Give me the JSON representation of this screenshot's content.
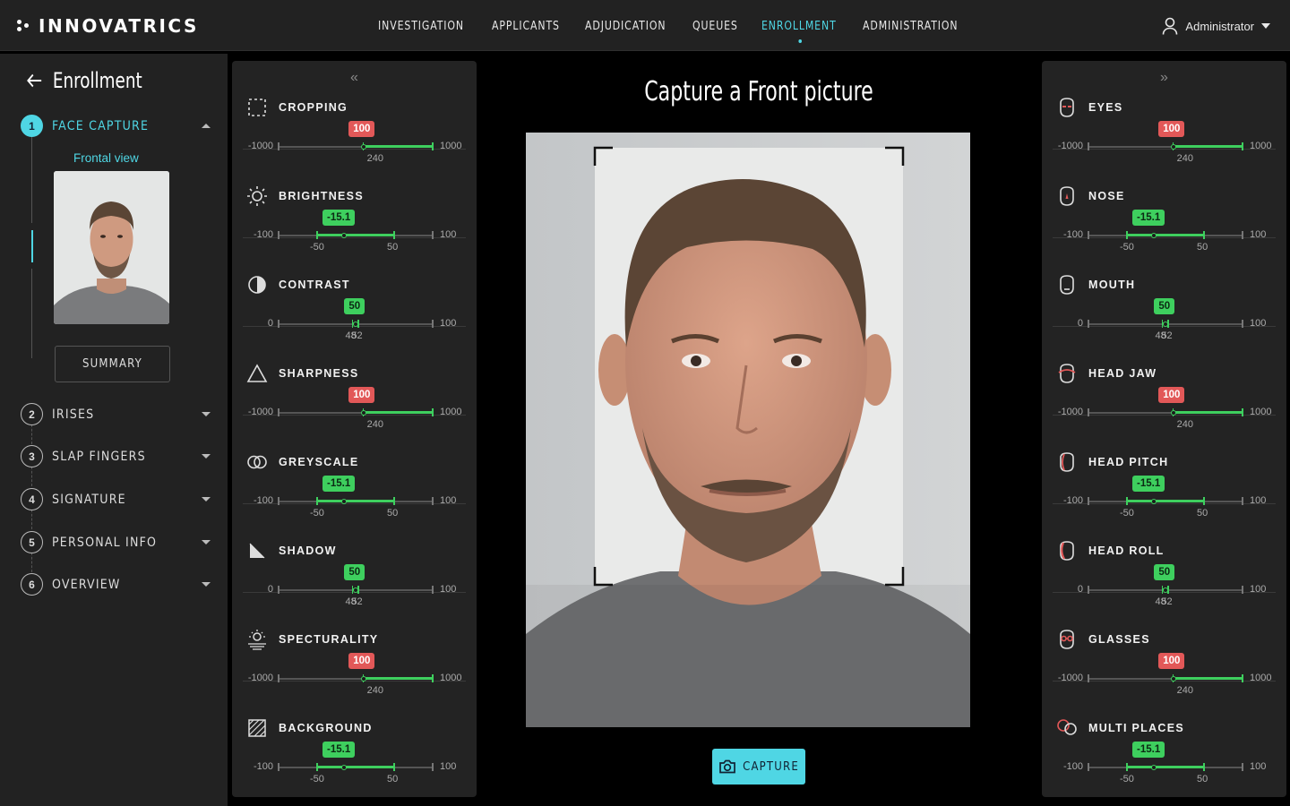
{
  "brand": {
    "name": "INNOVATRICS"
  },
  "nav": {
    "items": [
      "INVESTIGATION",
      "APPLICANTS",
      "ADJUDICATION",
      "QUEUES",
      "ENROLLMENT",
      "ADMINISTRATION"
    ],
    "active": "ENROLLMENT"
  },
  "user": {
    "name": "Administrator",
    "icon": "user-icon"
  },
  "sidebar": {
    "title": "Enrollment",
    "frontal_label": "Frontal view",
    "summary_label": "SUMMARY",
    "steps": [
      {
        "num": "1",
        "label": "FACE CAPTURE",
        "active": true
      },
      {
        "num": "2",
        "label": "IRISES"
      },
      {
        "num": "3",
        "label": "SLAP FINGERS"
      },
      {
        "num": "4",
        "label": "SIGNATURE"
      },
      {
        "num": "5",
        "label": "PERSONAL INFO"
      },
      {
        "num": "6",
        "label": "OVERVIEW"
      }
    ]
  },
  "center": {
    "title": "Capture a Front picture",
    "capture_label": "CAPTURE"
  },
  "left_panel": {
    "collapse_glyph": "«",
    "controls": [
      {
        "name": "CROPPING",
        "icon": "crop-icon",
        "min": "-1000",
        "max": "1000",
        "value": "100",
        "status": "red",
        "marks": [
          "240"
        ],
        "range": [
          -1000,
          1000
        ],
        "green_from": 100,
        "green_to": 1000,
        "ticks": [
          100,
          1000
        ],
        "mark_vals": [
          240
        ]
      },
      {
        "name": "BRIGHTNESS",
        "icon": "sun-icon",
        "min": "-100",
        "max": "100",
        "value": "-15.1",
        "status": "green",
        "marks": [
          "-50",
          "50"
        ],
        "range": [
          -100,
          100
        ],
        "green_from": -50,
        "green_to": 50,
        "ticks": [
          -50,
          50
        ],
        "mark_vals": [
          -50,
          50
        ],
        "knob": -15.1
      },
      {
        "name": "CONTRAST",
        "icon": "contrast-icon",
        "min": "0",
        "max": "100",
        "value": "50",
        "status": "green",
        "marks": [
          "48",
          "52"
        ],
        "range": [
          0,
          100
        ],
        "green_from": 48,
        "green_to": 52,
        "ticks": [
          48,
          52
        ],
        "mark_vals": [
          48,
          52
        ],
        "knob": 50
      },
      {
        "name": "SHARPNESS",
        "icon": "triangle-icon",
        "min": "-1000",
        "max": "1000",
        "value": "100",
        "status": "red",
        "marks": [
          "240"
        ],
        "range": [
          -1000,
          1000
        ],
        "green_from": 100,
        "green_to": 1000,
        "ticks": [
          100,
          1000
        ],
        "mark_vals": [
          240
        ]
      },
      {
        "name": "GREYSCALE",
        "icon": "circles-icon",
        "min": "-100",
        "max": "100",
        "value": "-15.1",
        "status": "green",
        "marks": [
          "-50",
          "50"
        ],
        "range": [
          -100,
          100
        ],
        "green_from": -50,
        "green_to": 50,
        "ticks": [
          -50,
          50
        ],
        "mark_vals": [
          -50,
          50
        ],
        "knob": -15.1
      },
      {
        "name": "SHADOW",
        "icon": "shadow-icon",
        "min": "0",
        "max": "100",
        "value": "50",
        "status": "green",
        "marks": [
          "48",
          "52"
        ],
        "range": [
          0,
          100
        ],
        "green_from": 48,
        "green_to": 52,
        "ticks": [
          48,
          52
        ],
        "mark_vals": [
          48,
          52
        ],
        "knob": 50
      },
      {
        "name": "SPECTURALITY",
        "icon": "specularity-icon",
        "min": "-1000",
        "max": "1000",
        "value": "100",
        "status": "red",
        "marks": [
          "240"
        ],
        "range": [
          -1000,
          1000
        ],
        "green_from": 100,
        "green_to": 1000,
        "ticks": [
          100,
          1000
        ],
        "mark_vals": [
          240
        ]
      },
      {
        "name": "BACKGROUND",
        "icon": "background-icon",
        "min": "-100",
        "max": "100",
        "value": "-15.1",
        "status": "green",
        "marks": [
          "-50",
          "50"
        ],
        "range": [
          -100,
          100
        ],
        "green_from": -50,
        "green_to": 50,
        "ticks": [
          -50,
          50
        ],
        "mark_vals": [
          -50,
          50
        ],
        "knob": -15.1
      }
    ]
  },
  "right_panel": {
    "collapse_glyph": "»",
    "controls": [
      {
        "name": "EYES",
        "icon": "eyes-icon",
        "min": "-1000",
        "max": "1000",
        "value": "100",
        "status": "red",
        "marks": [
          "240"
        ],
        "range": [
          -1000,
          1000
        ],
        "green_from": 100,
        "green_to": 1000,
        "ticks": [
          100,
          1000
        ],
        "mark_vals": [
          240
        ]
      },
      {
        "name": "NOSE",
        "icon": "nose-icon",
        "min": "-100",
        "max": "100",
        "value": "-15.1",
        "status": "green",
        "marks": [
          "-50",
          "50"
        ],
        "range": [
          -100,
          100
        ],
        "green_from": -50,
        "green_to": 50,
        "ticks": [
          -50,
          50
        ],
        "mark_vals": [
          -50,
          50
        ],
        "knob": -15.1
      },
      {
        "name": "MOUTH",
        "icon": "mouth-icon",
        "min": "0",
        "max": "100",
        "value": "50",
        "status": "green",
        "marks": [
          "48",
          "52"
        ],
        "range": [
          0,
          100
        ],
        "green_from": 48,
        "green_to": 52,
        "ticks": [
          48,
          52
        ],
        "mark_vals": [
          48,
          52
        ],
        "knob": 50
      },
      {
        "name": "HEAD JAW",
        "icon": "head-jaw-icon",
        "min": "-1000",
        "max": "1000",
        "value": "100",
        "status": "red",
        "marks": [
          "240"
        ],
        "range": [
          -1000,
          1000
        ],
        "green_from": 100,
        "green_to": 1000,
        "ticks": [
          100,
          1000
        ],
        "mark_vals": [
          240
        ]
      },
      {
        "name": "HEAD PITCH",
        "icon": "head-pitch-icon",
        "min": "-100",
        "max": "100",
        "value": "-15.1",
        "status": "green",
        "marks": [
          "-50",
          "50"
        ],
        "range": [
          -100,
          100
        ],
        "green_from": -50,
        "green_to": 50,
        "ticks": [
          -50,
          50
        ],
        "mark_vals": [
          -50,
          50
        ],
        "knob": -15.1
      },
      {
        "name": "HEAD ROLL",
        "icon": "head-roll-icon",
        "min": "0",
        "max": "100",
        "value": "50",
        "status": "green",
        "marks": [
          "48",
          "52"
        ],
        "range": [
          0,
          100
        ],
        "green_from": 48,
        "green_to": 52,
        "ticks": [
          48,
          52
        ],
        "mark_vals": [
          48,
          52
        ],
        "knob": 50
      },
      {
        "name": "GLASSES",
        "icon": "glasses-icon",
        "min": "-1000",
        "max": "1000",
        "value": "100",
        "status": "red",
        "marks": [
          "240"
        ],
        "range": [
          -1000,
          1000
        ],
        "green_from": 100,
        "green_to": 1000,
        "ticks": [
          100,
          1000
        ],
        "mark_vals": [
          240
        ]
      },
      {
        "name": "MULTI PLACES",
        "icon": "multi-faces-icon",
        "min": "-100",
        "max": "100",
        "value": "-15.1",
        "status": "green",
        "marks": [
          "-50",
          "50"
        ],
        "range": [
          -100,
          100
        ],
        "green_from": -50,
        "green_to": 50,
        "ticks": [
          -50,
          50
        ],
        "mark_vals": [
          -50,
          50
        ],
        "knob": -15.1
      }
    ]
  },
  "colors": {
    "accent": "#4fd6e4",
    "ok": "#3ecf5e",
    "bad": "#e25858",
    "panel": "#232323",
    "bg": "#000000"
  }
}
